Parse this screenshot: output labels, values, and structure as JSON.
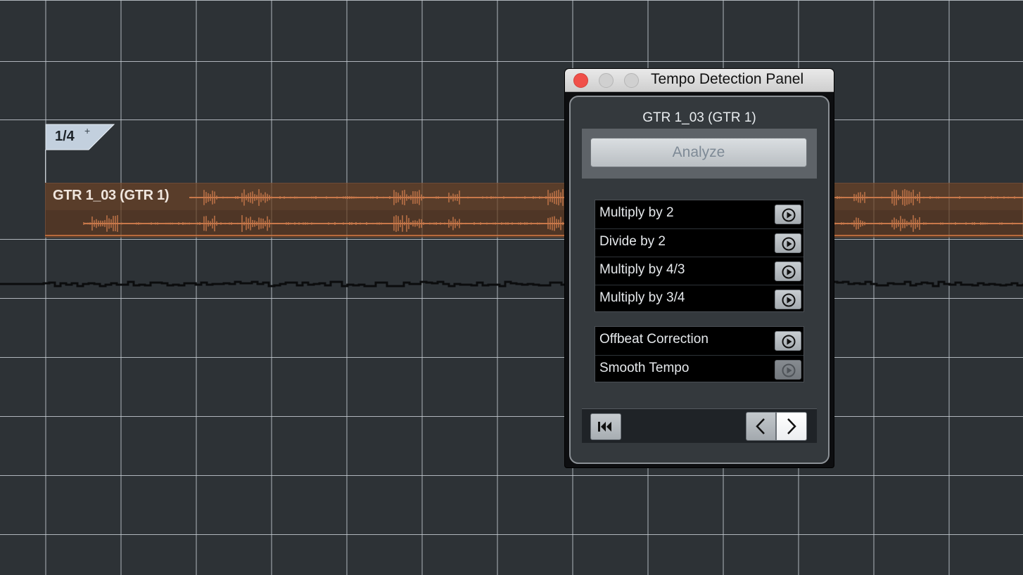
{
  "arrange": {
    "signature": {
      "label": "1/4",
      "add_symbol": "+"
    },
    "event": {
      "name": "GTR 1_03 (GTR 1)"
    }
  },
  "panel": {
    "window_title": "Tempo Detection Panel",
    "event_name": "GTR 1_03 (GTR 1)",
    "analyze_label": "Analyze",
    "tempo_operations": [
      {
        "label": "Multiply by 2",
        "icon": "play-icon"
      },
      {
        "label": "Divide by 2",
        "icon": "play-icon"
      },
      {
        "label": "Multiply by 4/3",
        "icon": "play-icon"
      },
      {
        "label": "Multiply by 3/4",
        "icon": "play-icon"
      }
    ],
    "correction_operations": [
      {
        "label": "Offbeat Correction",
        "icon": "play-icon",
        "enabled": true
      },
      {
        "label": "Smooth Tempo",
        "icon": "play-icon",
        "enabled": false
      }
    ],
    "nav_icons": [
      "go-to-start-icon",
      "chevron-left-icon",
      "chevron-right-icon"
    ]
  },
  "colors": {
    "background": "#2d3236",
    "grid": "#c8ced4",
    "event_fill": "#4f3626",
    "waveform": "#c8784a",
    "close_button": "#f0504a"
  }
}
